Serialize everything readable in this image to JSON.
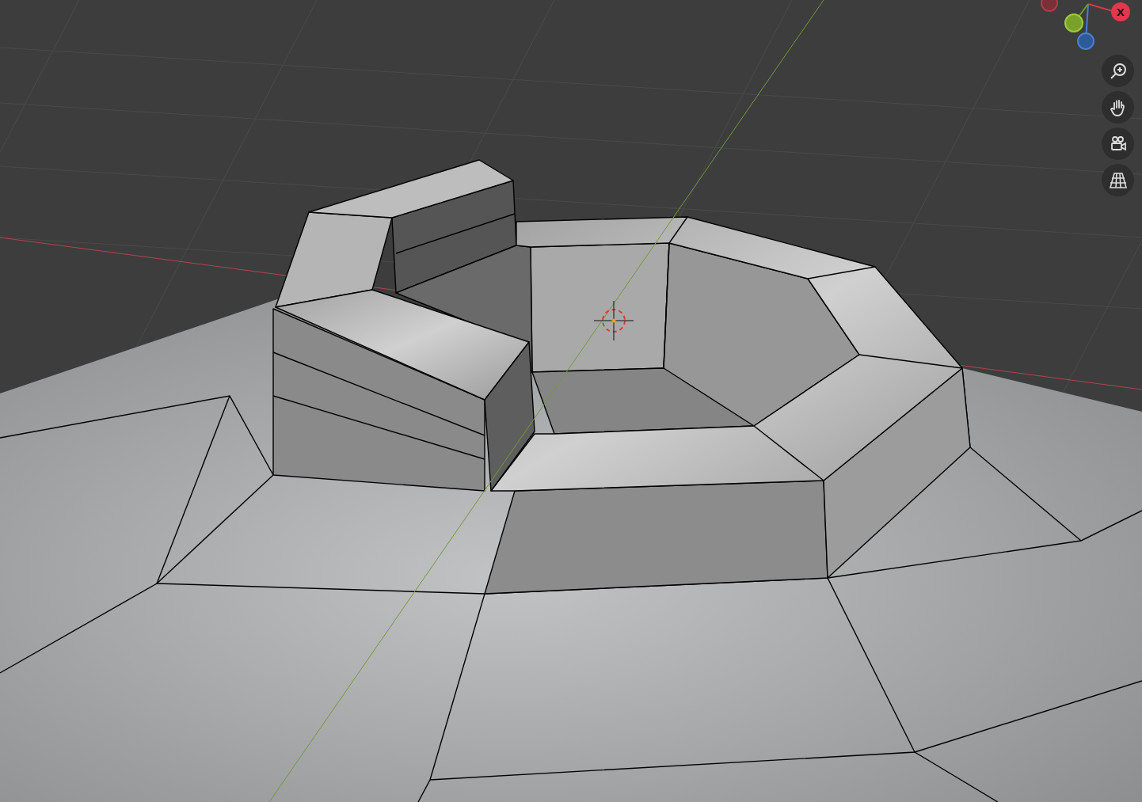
{
  "viewport": {
    "navigation_gizmo": {
      "x_axis_label": "X"
    },
    "tools": [
      {
        "kind": "zoom"
      },
      {
        "kind": "pan"
      },
      {
        "kind": "camera"
      },
      {
        "kind": "perspective"
      }
    ]
  }
}
